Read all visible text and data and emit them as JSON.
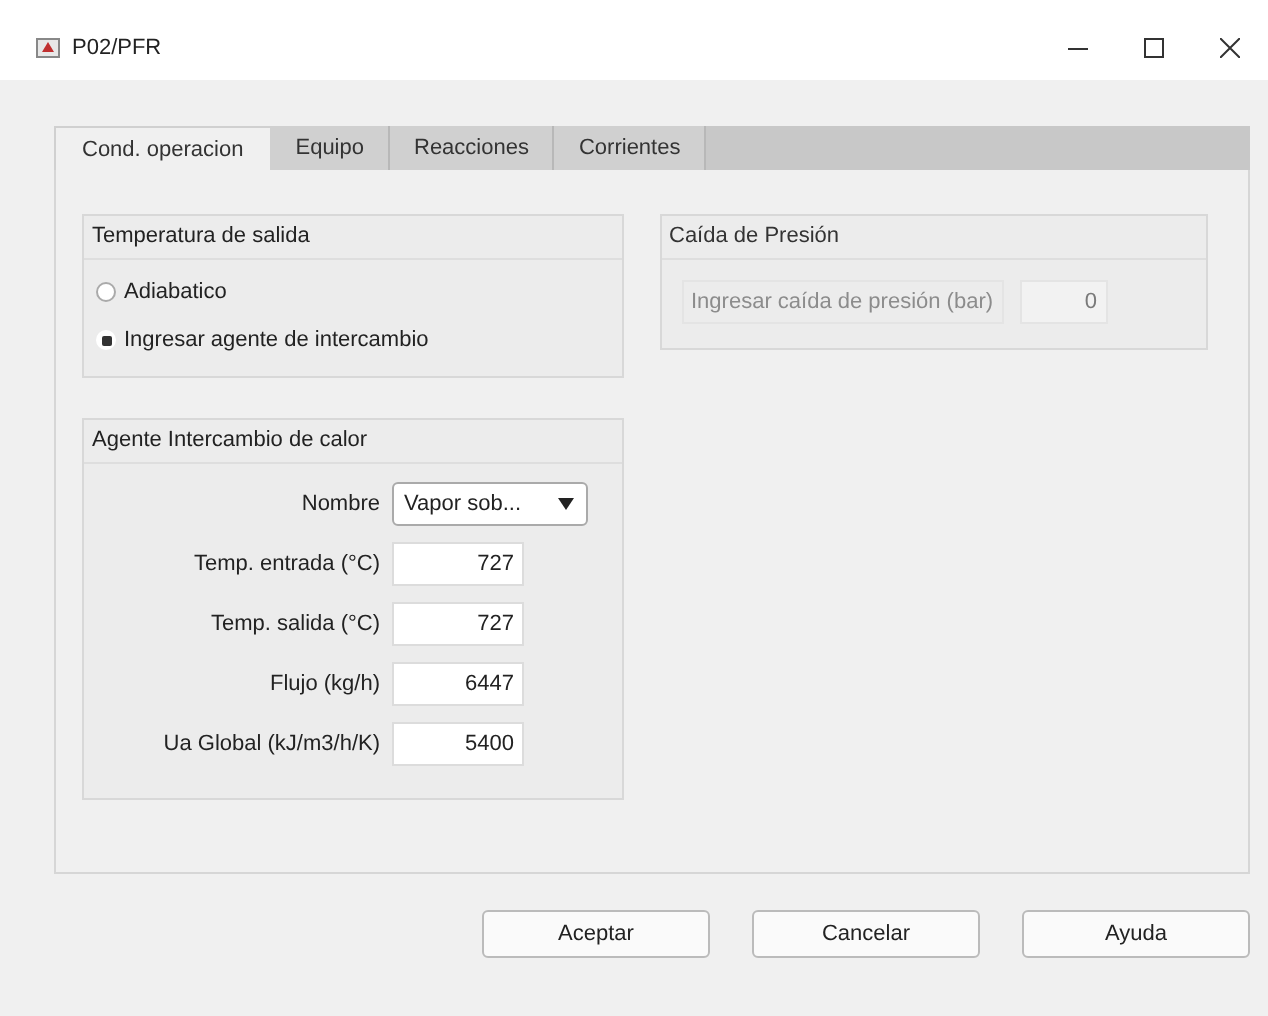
{
  "window": {
    "title": "P02/PFR"
  },
  "tabs": [
    {
      "label": "Cond. operacion",
      "selected": true
    },
    {
      "label": "Equipo",
      "selected": false
    },
    {
      "label": "Reacciones",
      "selected": false
    },
    {
      "label": "Corrientes",
      "selected": false
    }
  ],
  "outlet_temperature": {
    "title": "Temperatura de salida",
    "options": [
      {
        "label": "Adiabatico",
        "selected": false
      },
      {
        "label": "Ingresar agente de intercambio",
        "selected": true
      }
    ]
  },
  "heat_agent": {
    "title": "Agente Intercambio de calor",
    "name_label": "Nombre",
    "name_value": "Vapor sob...",
    "fields": [
      {
        "label": "Temp. entrada (°C)",
        "value": "727"
      },
      {
        "label": "Temp. salida (°C)",
        "value": "727"
      },
      {
        "label": "Flujo (kg/h)",
        "value": "6447"
      },
      {
        "label": "Ua Global (kJ/m3/h/K)",
        "value": "5400"
      }
    ]
  },
  "pressure_drop": {
    "title": "Caída de Presión",
    "label": "Ingresar caída de presión (bar)",
    "value": "0",
    "disabled": true
  },
  "buttons": [
    "Aceptar",
    "Cancelar",
    "Ayuda"
  ]
}
